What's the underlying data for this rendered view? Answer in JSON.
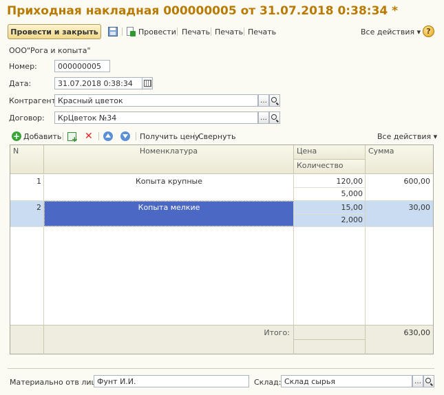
{
  "window": {
    "title": "Приходная накладная 000000005 от 31.07.2018 0:38:34 *"
  },
  "toolbar": {
    "post_close": "Провести и закрыть",
    "save_icon": "save-icon",
    "post": "Провести",
    "print1": "Печать",
    "print2": "Печать",
    "print3": "Печать",
    "all_actions": "Все действия ▾",
    "help": "?"
  },
  "header": {
    "organization": "ООО\"Рога и копыта\"",
    "number_label": "Номер:",
    "number_value": "000000005",
    "date_label": "Дата:",
    "date_value": "31.07.2018  0:38:34",
    "counterparty_label": "Контрагент:",
    "counterparty_value": "Красный цветок",
    "contract_label": "Договор:",
    "contract_value": "КрЦветок №34"
  },
  "grid_toolbar": {
    "add": "Добавить",
    "get_price": "Получить цену",
    "collapse": "Свернуть",
    "all_actions": "Все действия ▾"
  },
  "table": {
    "columns": {
      "n": "N",
      "item": "Номенклатура",
      "price": "Цена",
      "qty": "Количество",
      "sum": "Сумма"
    },
    "rows": [
      {
        "n": "1",
        "item": "Копыта крупные",
        "price": "120,00",
        "qty": "5,000",
        "sum": "600,00"
      },
      {
        "n": "2",
        "item": "Копыта мелкие",
        "price": "15,00",
        "qty": "2,000",
        "sum": "30,00"
      }
    ],
    "total_label": "Итого:",
    "total_value": "630,00"
  },
  "footer": {
    "responsible_label": "Материально отв лицо:",
    "responsible_value": "Фунт И.И.",
    "warehouse_label": "Склад:",
    "warehouse_value": "Склад сырья"
  },
  "colors": {
    "title": "#b87a00",
    "selection": "#4b68c4",
    "row_highlight": "#c9dcf2"
  }
}
